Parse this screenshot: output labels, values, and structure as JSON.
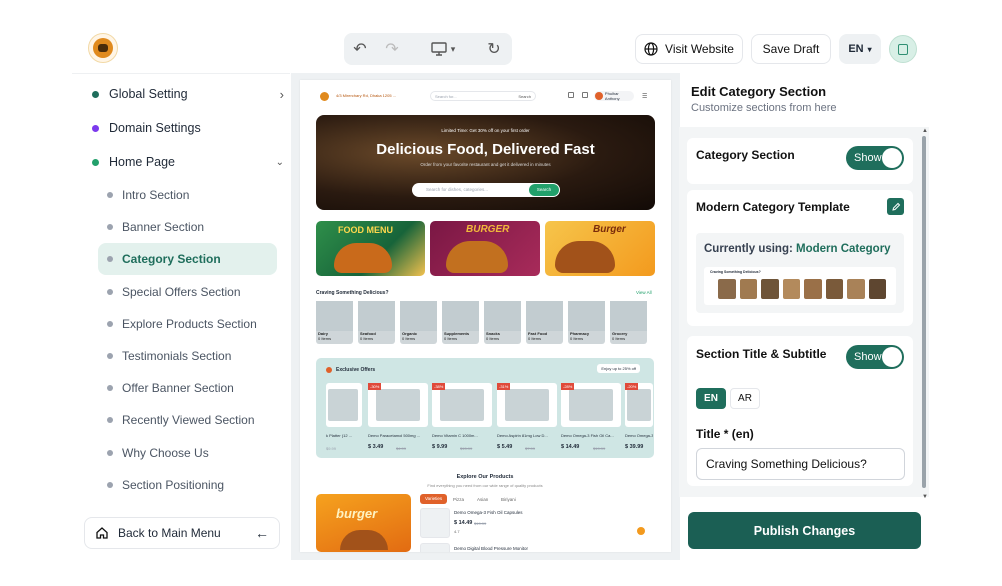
{
  "toolbar": {
    "visit_label": "Visit Website",
    "draft_label": "Save Draft",
    "lang": "EN"
  },
  "sidebar": {
    "items": [
      {
        "label": "Global Setting",
        "color": "#1f6e5c"
      },
      {
        "label": "Domain Settings",
        "color": "#7c3aed"
      },
      {
        "label": "Home Page",
        "color": "#22a06b"
      }
    ],
    "subitems": [
      "Intro Section",
      "Banner Section",
      "Category Section",
      "Special Offers Section",
      "Explore Products Section",
      "Testimonials Section",
      "Offer Banner Section",
      "Recently Viewed Section",
      "Why Choose Us",
      "Section Positioning"
    ],
    "back_label": "Back to Main Menu"
  },
  "preview": {
    "address": "4/3 Mirerchary Rd, Dhaka 1205 ...",
    "search_placeholder": "Search for...",
    "search_btn": "Search",
    "user": "Phulhar Anthony",
    "promo": "Limited Time: Get 30% off on your first order",
    "hero_title": "Delicious Food, Delivered Fast",
    "hero_sub": "Order from your favorite restaurant and get it delivered in minutes",
    "hero_placeholder": "Search for dishes, categories...",
    "hero_btn": "Search",
    "banners": [
      "FOOD MENU",
      "BURGER",
      "Burger"
    ],
    "cat_title": "Craving Something Delicious?",
    "view_all": "View All",
    "categories": [
      {
        "name": "Dairy",
        "count": "0 Items"
      },
      {
        "name": "Seafood",
        "count": "0 Items"
      },
      {
        "name": "Organic",
        "count": "0 Items"
      },
      {
        "name": "Supplements",
        "count": "0 Items"
      },
      {
        "name": "Snacks",
        "count": "0 Items"
      },
      {
        "name": "Fast Food",
        "count": "0 Items"
      },
      {
        "name": "Pharmacy",
        "count": "0 Items"
      },
      {
        "name": "Grocery",
        "count": "0 Items"
      }
    ],
    "offers_title": "Exclusive Offers",
    "offers_badge": "Enjoy up to 25% off",
    "offers": [
      {
        "name": "k Platter (12 ...",
        "price": "",
        "old": "$9.99",
        "badge": ""
      },
      {
        "name": "Demo Paracetamol 500mg ...",
        "price": "$ 3.49",
        "old": "$4.99",
        "badge": "-30%"
      },
      {
        "name": "Demo Vitamin C 1000m...",
        "price": "$ 9.99",
        "old": "$15.99",
        "badge": "-38%"
      },
      {
        "name": "Demo Aspirin 81mg Low D...",
        "price": "$ 5.49",
        "old": "$7.99",
        "badge": "-31%"
      },
      {
        "name": "Demo Omega-3 Fish Oil Ca...",
        "price": "$ 14.49",
        "old": "$19.99",
        "badge": "-28%"
      },
      {
        "name": "Demo Omega-3 Fish Oil C...",
        "price": "$ 39.99",
        "old": "$49.99",
        "badge": "-20%"
      }
    ],
    "explore_title": "Explore Our Products",
    "explore_sub": "Find everything you need from our wide range of quality products",
    "tabs": [
      "Varieties",
      "Pizza",
      "Asian",
      "Biriyani"
    ],
    "products": [
      {
        "name": "Demo Omega-3 Fish Oil Capsules",
        "price": "$ 14.49",
        "old": "$19.99",
        "rating": "4.7"
      },
      {
        "name": "Demo Digital Blood Pressure Monitor",
        "price": "",
        "old": "",
        "rating": ""
      }
    ],
    "promo_card": "burger"
  },
  "right": {
    "title": "Edit Category Section",
    "subtitle": "Customize sections from here",
    "category_label": "Category Section",
    "show": "Show",
    "template_label": "Modern Category Template",
    "using_prefix": "Currently using:",
    "using_value": "Modern Category",
    "mini_title": "Craving Something Delicious?",
    "subtitle_label": "Section Title & Subtitle",
    "lang_en": "EN",
    "lang_ar": "AR",
    "title_field_label": "Title * (en)",
    "title_value": "Craving Something Delicious?",
    "publish": "Publish Changes"
  }
}
